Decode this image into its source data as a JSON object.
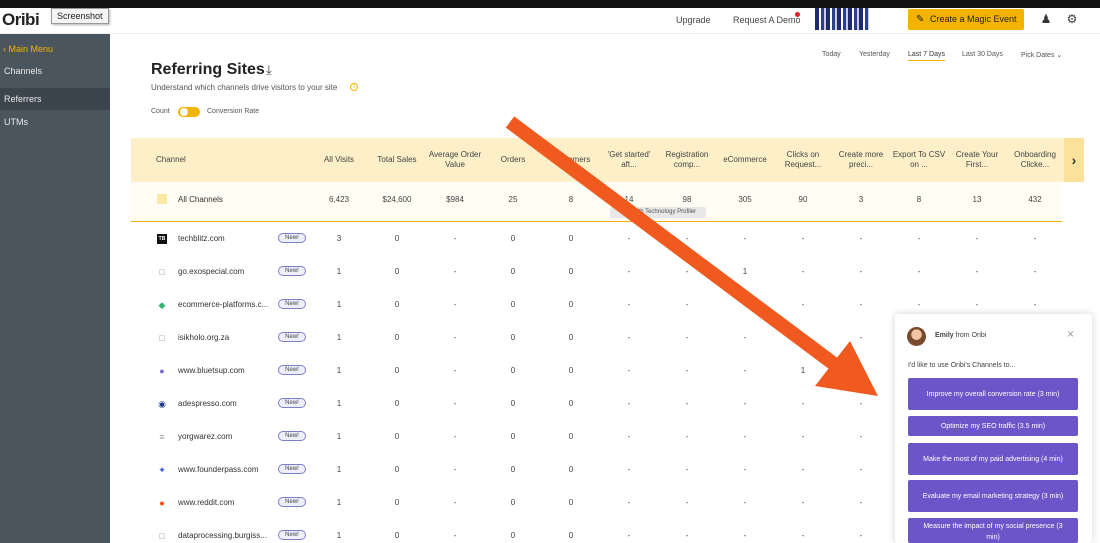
{
  "header": {
    "logo": "Oribi",
    "screenshot_tag": "Screenshot",
    "upgrade": "Upgrade",
    "request_demo": "Request A Demo",
    "magic_button": "Create a Magic Event"
  },
  "sidebar": {
    "back": "Main Menu",
    "items": [
      "Channels",
      "Referrers",
      "UTMs"
    ]
  },
  "page": {
    "title": "Referring Sites",
    "subtitle": "Understand which channels drive visitors to your site",
    "toggle_left": "Count",
    "toggle_right": "Conversion Rate"
  },
  "date_filters": [
    "Today",
    "Yesterday",
    "Last 7 Days",
    "Last 30 Days",
    "Pick Dates"
  ],
  "table": {
    "columns": [
      "Channel",
      "All Visits",
      "Total Sales",
      "Average Order Value",
      "Orders",
      "Customers",
      "'Get started' aft...",
      "Registration comp...",
      "eCommerce",
      "Clicks on Request...",
      "Create more preci...",
      "Export To CSV on ...",
      "Create Your First...",
      "Onboarding Clicke..."
    ],
    "all_channels": {
      "name": "All Channels",
      "values": [
        "6,423",
        "$24,600",
        "$984",
        "25",
        "8",
        "14",
        "98",
        "305",
        "90",
        "3",
        "8",
        "13",
        "432"
      ]
    },
    "tooltip": "BuiltWith Technology Profiler",
    "new_label": "New!",
    "rows": [
      {
        "name": "techblitz.com",
        "icon": "TB",
        "values": [
          "3",
          "0",
          "-",
          "0",
          "0",
          "-",
          "-",
          "-",
          "-",
          "-",
          "-",
          "-",
          "-"
        ]
      },
      {
        "name": "go.exospecial.com",
        "icon": "□",
        "values": [
          "1",
          "0",
          "-",
          "0",
          "0",
          "-",
          "-",
          "1",
          "-",
          "-",
          "-",
          "-",
          "-"
        ]
      },
      {
        "name": "ecommerce-platforms.c...",
        "icon": "◆",
        "values": [
          "1",
          "0",
          "-",
          "0",
          "0",
          "-",
          "-",
          "-",
          "-",
          "-",
          "-",
          "-",
          "-"
        ]
      },
      {
        "name": "isikholo.org.za",
        "icon": "□",
        "values": [
          "1",
          "0",
          "-",
          "0",
          "0",
          "-",
          "-",
          "-",
          "-",
          "-",
          "-",
          "-",
          "-"
        ]
      },
      {
        "name": "www.bluetsup.com",
        "icon": "●",
        "values": [
          "1",
          "0",
          "-",
          "0",
          "0",
          "-",
          "-",
          "-",
          "1",
          "-",
          "-",
          "-",
          "-"
        ]
      },
      {
        "name": "adespresso.com",
        "icon": "◉",
        "values": [
          "1",
          "0",
          "-",
          "0",
          "0",
          "-",
          "-",
          "-",
          "-",
          "-",
          "-",
          "-",
          "-"
        ]
      },
      {
        "name": "yorgwarez.com",
        "icon": "≡",
        "values": [
          "1",
          "0",
          "-",
          "0",
          "0",
          "-",
          "-",
          "-",
          "-",
          "-",
          "-",
          "-",
          "-"
        ]
      },
      {
        "name": "www.founderpass.com",
        "icon": "✦",
        "values": [
          "1",
          "0",
          "-",
          "0",
          "0",
          "-",
          "-",
          "-",
          "-",
          "-",
          "-",
          "-",
          "-"
        ]
      },
      {
        "name": "www.reddit.com",
        "icon": "●",
        "values": [
          "1",
          "0",
          "-",
          "0",
          "0",
          "-",
          "-",
          "-",
          "-",
          "-",
          "-",
          "-",
          "-"
        ]
      },
      {
        "name": "dataprocessing.burgiss...",
        "icon": "□",
        "values": [
          "1",
          "0",
          "-",
          "0",
          "0",
          "-",
          "-",
          "-",
          "-",
          "-",
          "-",
          "-",
          "-"
        ]
      }
    ]
  },
  "chat": {
    "name": "Emily",
    "from": "from Oribi",
    "message": "I'd like to use Oribi's Channels to...",
    "options": [
      "Improve my overall conversion rate (3 min)",
      "Optimize my SEO traffic (3.5 min)",
      "Make the most of my paid advertising (4 min)",
      "Evaluate my email marketing strategy (3 min)",
      "Measure the impact of my social presence (3 min)"
    ]
  },
  "colors": {
    "accent": "#f4b300",
    "sidebar": "#4b555e",
    "chat_button": "#6b55c8",
    "arrow": "#f05a1e"
  }
}
